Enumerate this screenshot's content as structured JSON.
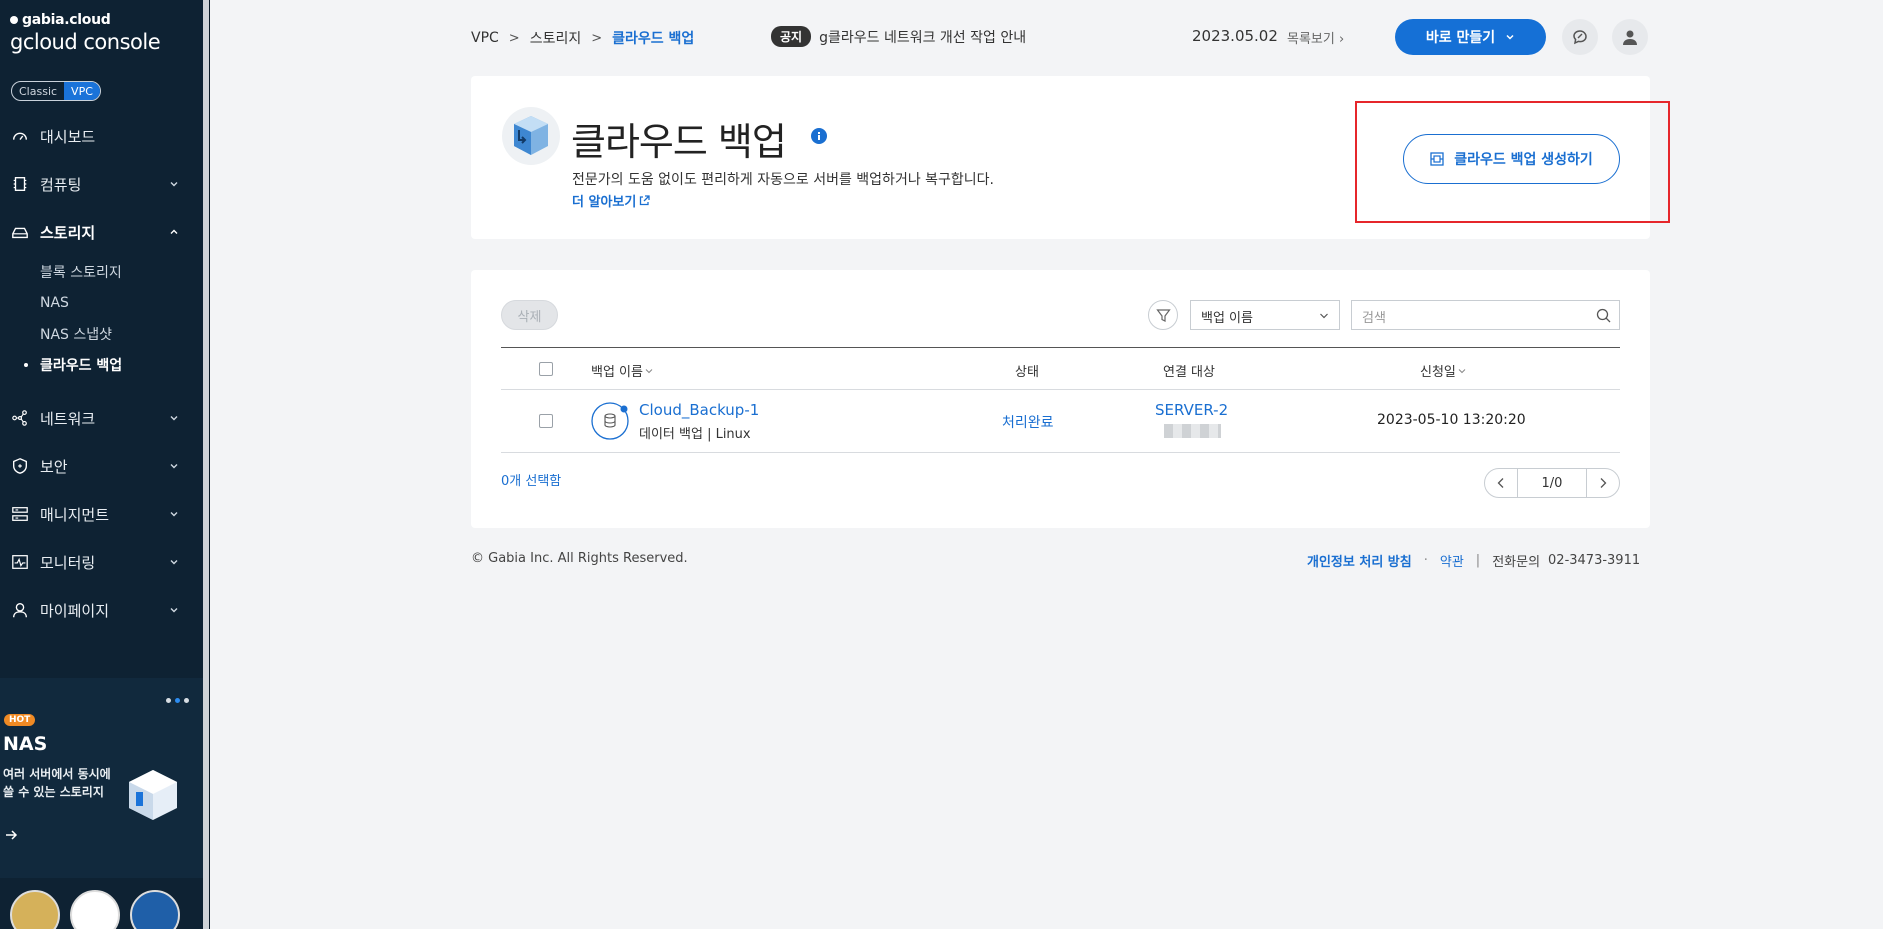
{
  "brand": {
    "top": "gabia.cloud",
    "main": "gcloud console"
  },
  "mode": {
    "classic": "Classic",
    "vpc": "VPC"
  },
  "nav": {
    "dashboard": "대시보드",
    "computing": "컴퓨팅",
    "storage": "스토리지",
    "storage_sub": [
      "블록 스토리지",
      "NAS",
      "NAS 스냅샷",
      "클라우드 백업"
    ],
    "network": "네트워크",
    "security": "보안",
    "management": "매니지먼트",
    "monitoring": "모니터링",
    "mypage": "마이페이지"
  },
  "promo": {
    "hot": "HOT",
    "title": "NAS",
    "desc": "여러 서버에서 동시에 쓸 수 있는 스토리지"
  },
  "breadcrumb": [
    "VPC",
    "스토리지",
    "클라우드 백업"
  ],
  "notice": {
    "tag": "공지",
    "text": "g클라우드 네트워크 개선 작업 안내",
    "date": "2023.05.02",
    "list": "목록보기"
  },
  "quick": {
    "label": "바로 만들기"
  },
  "header": {
    "title": "클라우드 백업",
    "desc": "전문가의 도움 없이도 편리하게 자동으로 서버를 백업하거나 복구합니다.",
    "learn_more": "더 알아보기",
    "create": "클라우드 백업 생성하기"
  },
  "list": {
    "delete": "삭제",
    "select_value": "백업 이름",
    "search_placeholder": "검색",
    "columns": {
      "name": "백업 이름",
      "status": "상태",
      "target": "연결 대상",
      "date": "신청일"
    },
    "rows": [
      {
        "name": "Cloud_Backup-1",
        "sub": "데이터 백업 | Linux",
        "status": "처리완료",
        "target": "SERVER-2",
        "date": "2023-05-10 13:20:20"
      }
    ],
    "selected": "0개 선택함",
    "page": "1/0"
  },
  "footer": {
    "copyright": "© Gabia Inc. All Rights Reserved.",
    "privacy": "개인정보 처리 방침",
    "dot": "·",
    "terms": "약관",
    "pipe": "|",
    "phone_label": "전화문의",
    "phone": "02-3473-3911"
  },
  "colors": {
    "accent": "#1a6fd1",
    "sidebar": "#0e2233",
    "highlight": "#e6262b"
  }
}
